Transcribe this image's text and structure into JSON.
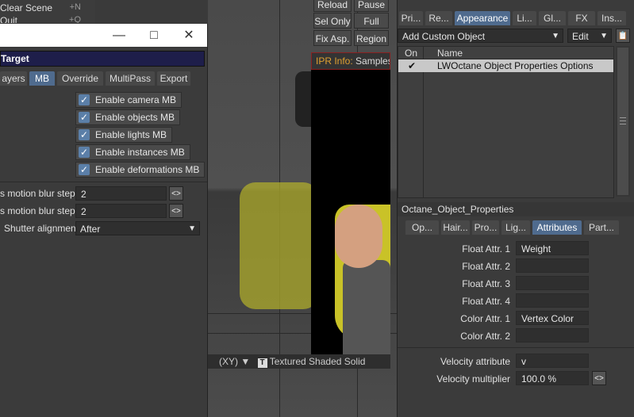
{
  "menu": {
    "items": [
      {
        "label": "Clear Scene",
        "shortcut": "+N"
      },
      {
        "label": "Quit",
        "shortcut": "+Q"
      }
    ]
  },
  "target_window": {
    "title": "Target",
    "tabs": [
      "ayers",
      "MB",
      "Override",
      "MultiPass",
      "Export"
    ],
    "active_tab": "MB",
    "checkboxes": [
      {
        "label": "Enable camera MB",
        "checked": true
      },
      {
        "label": "Enable objects MB",
        "checked": true
      },
      {
        "label": "Enable lights MB",
        "checked": true
      },
      {
        "label": "Enable instances MB",
        "checked": true
      },
      {
        "label": "Enable deformations MB",
        "checked": true
      }
    ],
    "fields": [
      {
        "label": "s motion blur steps",
        "value": "2"
      },
      {
        "label": "s motion blur steps",
        "value": "2"
      }
    ],
    "shutter": {
      "label": "Shutter alignment",
      "value": "After"
    }
  },
  "toolbar": {
    "reload": "Reload",
    "pause": "Pause",
    "sel_only": "Sel Only",
    "full_upd": "Full Upd.",
    "fix_asp": "Fix Asp.",
    "region": "Region"
  },
  "ipr": {
    "label": "IPR Info:",
    "value": "Samples:"
  },
  "viewport": {
    "view": "(XY)",
    "mode": "Textured Shaded Solid",
    "mode_icon": "T"
  },
  "right_panel": {
    "tabs": [
      "Pri...",
      "Re...",
      "Appearance",
      "Li...",
      "Gl...",
      "FX",
      "Ins..."
    ],
    "active_tab": "Appearance",
    "add_custom_object": "Add Custom Object",
    "edit": "Edit",
    "list_headers": {
      "on": "On",
      "name": "Name"
    },
    "list_rows": [
      {
        "on": "✔",
        "name": "LWOctane Object Properties Options"
      }
    ],
    "section_title": "Octane_Object_Properties",
    "sub_tabs": [
      "Op...",
      "Hair...",
      "Pro...",
      "Lig...",
      "Attributes",
      "Part..."
    ],
    "active_sub_tab": "Attributes",
    "attributes": [
      {
        "label": "Float Attr. 1",
        "value": "Weight"
      },
      {
        "label": "Float Attr. 2",
        "value": ""
      },
      {
        "label": "Float Attr. 3",
        "value": ""
      },
      {
        "label": "Float Attr. 4",
        "value": ""
      },
      {
        "label": "Color Attr. 1",
        "value": "Vertex Color"
      },
      {
        "label": "Color Attr. 2",
        "value": ""
      }
    ],
    "velocity_attribute": {
      "label": "Velocity attribute",
      "value": "v"
    },
    "velocity_multiplier": {
      "label": "Velocity multiplier",
      "value": "100.0 %"
    }
  },
  "colors": {
    "accent": "#4f6b8e",
    "title_bar": "#1e1e4a",
    "ipr_border": "#8a2020"
  }
}
